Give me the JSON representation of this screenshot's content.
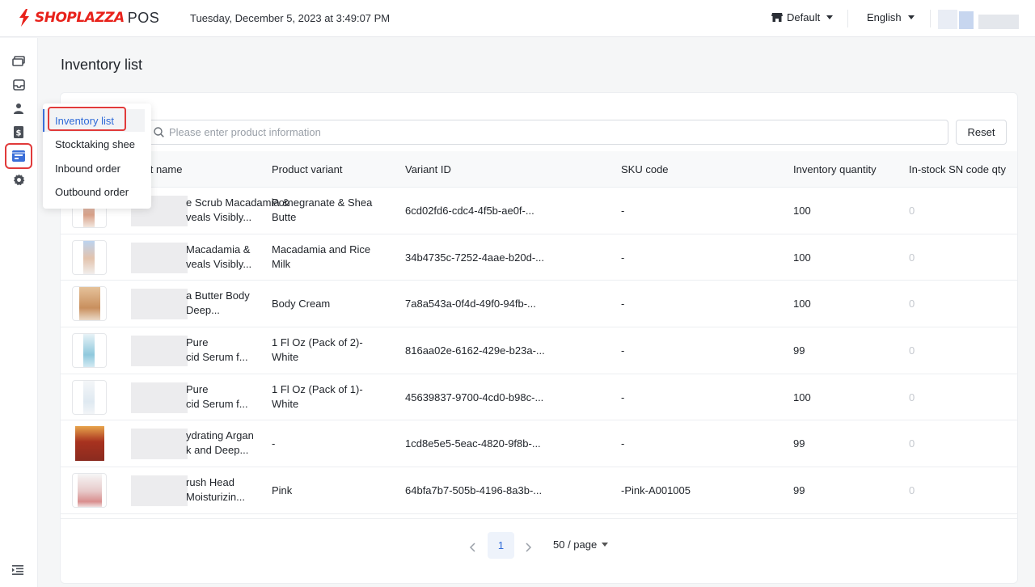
{
  "header": {
    "brand": "SHOPLAZZA",
    "product": "POS",
    "datetime": "Tuesday, December 5, 2023 at 3:49:07 PM",
    "store": "Default",
    "language": "English"
  },
  "sidebar": {
    "icons": [
      "orders-icon",
      "inbox-icon",
      "user-icon",
      "dollar-icon",
      "inventory-icon",
      "gear-icon"
    ],
    "active": "inventory-icon"
  },
  "page": {
    "title": "Inventory list"
  },
  "dropdown": {
    "items": [
      "Inventory list",
      "Stocktaking shee",
      "Inbound order",
      "Outbound order"
    ],
    "active_index": 0
  },
  "search": {
    "placeholder": "Please enter product information",
    "value": ""
  },
  "reset_label": "Reset",
  "table": {
    "columns": [
      "uct name",
      "Product variant",
      "Variant ID",
      "SKU code",
      "Inventory quantity",
      "In-stock SN code qty"
    ],
    "rows": [
      {
        "name1": "e Scrub Macadamia &",
        "name2": "veals Visibly...",
        "variant1": "Pomegranate & Shea",
        "variant2": "Butte",
        "variant_id": "6cd02fd6-cdc4-4f5b-ae0f-...",
        "sku": "-",
        "qty": "100",
        "sn": "0"
      },
      {
        "name1": "Macadamia &",
        "name2": "veals Visibly...",
        "variant1": "Macadamia and Rice",
        "variant2": "Milk",
        "variant_id": "34b4735c-7252-4aae-b20d-...",
        "sku": "-",
        "qty": "100",
        "sn": "0"
      },
      {
        "name1": "a Butter Body",
        "name2": "Deep...",
        "variant1": "Body Cream",
        "variant2": "",
        "variant_id": "7a8a543a-0f4d-49f0-94fb-...",
        "sku": "-",
        "qty": "100",
        "sn": "0"
      },
      {
        "name1": "Pure",
        "name2": "cid Serum f...",
        "variant1": "1 Fl Oz (Pack of 2)-",
        "variant2": "White",
        "variant_id": "816aa02e-6162-429e-b23a-...",
        "sku": "-",
        "qty": "99",
        "sn": "0"
      },
      {
        "name1": "Pure",
        "name2": "cid Serum f...",
        "variant1": "1 Fl Oz (Pack of 1)-",
        "variant2": "White",
        "variant_id": "45639837-9700-4cd0-b98c-...",
        "sku": "-",
        "qty": "100",
        "sn": "0"
      },
      {
        "name1": "ydrating Argan",
        "name2": "k and Deep...",
        "variant1": "-",
        "variant2": "",
        "variant_id": "1cd8e5e5-5eac-4820-9f8b-...",
        "sku": "-",
        "qty": "99",
        "sn": "0"
      },
      {
        "name1": "rush Head",
        "name2": "Moisturizin...",
        "variant1": "Pink",
        "variant2": "",
        "variant_id": "64bfa7b7-505b-4196-8a3b-...",
        "sku": "-Pink-A001005",
        "qty": "99",
        "sn": "0"
      }
    ]
  },
  "pagination": {
    "current": "1",
    "page_size": "50 / page"
  },
  "colors": {
    "brand": "#e8221b",
    "accent": "#2f6bd8",
    "highlight": "#e13a3a"
  }
}
